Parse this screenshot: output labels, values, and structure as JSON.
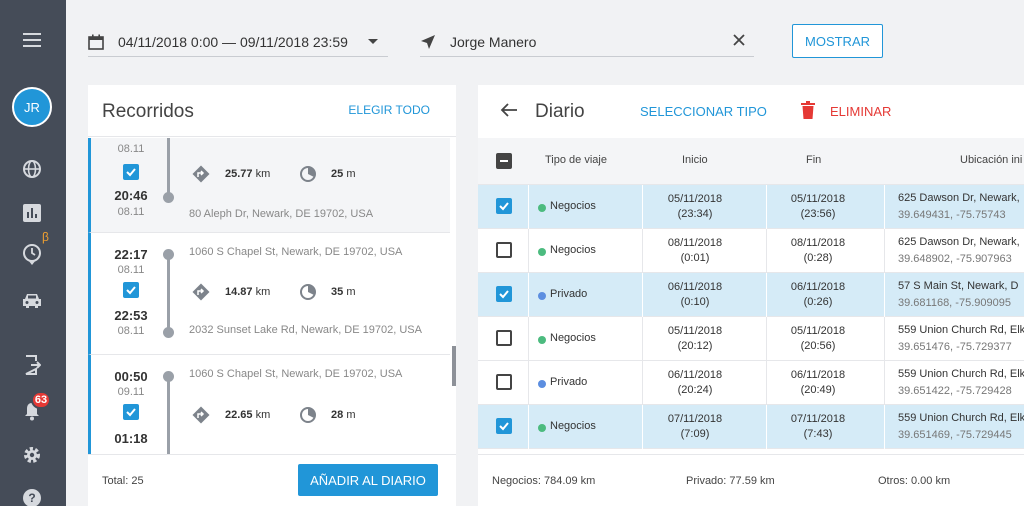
{
  "sidebar": {
    "avatar_initials": "JR",
    "beta_mark": "β",
    "notification_count": "63",
    "icons": [
      "menu-icon",
      "globe-icon",
      "bar-chart-icon",
      "clock-pin-icon",
      "car-icon",
      "logout-icon",
      "bell-icon",
      "gear-icon",
      "help-icon"
    ]
  },
  "filters": {
    "date_range": "04/11/2018 0:00 — 09/11/2018 23:59",
    "driver": "Jorge Manero",
    "show_button": "MOSTRAR"
  },
  "trips_panel": {
    "title": "Recorridos",
    "select_all": "ELEGIR TODO",
    "trips": [
      {
        "start_date": "08.11",
        "end_time": "20:46",
        "end_date": "08.11",
        "distance": "25.77",
        "distance_unit": "km",
        "duration": "25",
        "duration_unit": "m",
        "end_address": "80 Aleph Dr, Newark, DE 19702, USA"
      },
      {
        "start_time": "22:17",
        "start_date": "08.11",
        "end_time": "22:53",
        "end_date": "08.11",
        "distance": "14.87",
        "distance_unit": "km",
        "duration": "35",
        "duration_unit": "m",
        "start_address": "1060 S Chapel St, Newark, DE 19702, USA",
        "end_address": "2032 Sunset Lake Rd, Newark, DE 19702, USA"
      },
      {
        "start_time": "00:50",
        "start_date": "09.11",
        "end_time": "01:18",
        "distance": "22.65",
        "distance_unit": "km",
        "duration": "28",
        "duration_unit": "m",
        "start_address": "1060 S Chapel St, Newark, DE 19702, USA"
      }
    ],
    "total": "Total: 25",
    "add_button": "AÑADIR AL DIARIO"
  },
  "diary_panel": {
    "title": "Diario",
    "select_type": "SELECCIONAR TIPO",
    "delete": "ELIMINAR",
    "columns": [
      "Tipo de viaje",
      "Inicio",
      "Fin",
      "Ubicación ini"
    ],
    "rows": [
      {
        "checked": true,
        "type": "Negocios",
        "type_color": "#4cbb7f",
        "start_date": "05/11/2018",
        "start_time": "(23:34)",
        "end_date": "05/11/2018",
        "end_time": "(23:56)",
        "location": "625 Dawson Dr, Newark,",
        "coords": "39.649431, -75.75743"
      },
      {
        "checked": false,
        "type": "Negocios",
        "type_color": "#4cbb7f",
        "start_date": "08/11/2018",
        "start_time": "(0:01)",
        "end_date": "08/11/2018",
        "end_time": "(0:28)",
        "location": "625 Dawson Dr, Newark,",
        "coords": "39.648902, -75.907963"
      },
      {
        "checked": true,
        "type": "Privado",
        "type_color": "#5c8ee0",
        "start_date": "06/11/2018",
        "start_time": "(0:10)",
        "end_date": "06/11/2018",
        "end_time": "(0:26)",
        "location": "57 S Main St, Newark, D",
        "coords": "39.681168, -75.909095"
      },
      {
        "checked": false,
        "type": "Negocios",
        "type_color": "#4cbb7f",
        "start_date": "05/11/2018",
        "start_time": "(20:12)",
        "end_date": "05/11/2018",
        "end_time": "(20:56)",
        "location": "559 Union Church Rd, Elk",
        "coords": "39.651476, -75.729377"
      },
      {
        "checked": false,
        "type": "Privado",
        "type_color": "#5c8ee0",
        "start_date": "06/11/2018",
        "start_time": "(20:24)",
        "end_date": "06/11/2018",
        "end_time": "(20:49)",
        "location": "559 Union Church Rd, Elk",
        "coords": "39.651422, -75.729428"
      },
      {
        "checked": true,
        "type": "Negocios",
        "type_color": "#4cbb7f",
        "start_date": "07/11/2018",
        "start_time": "(7:09)",
        "end_date": "07/11/2018",
        "end_time": "(7:43)",
        "location": "559 Union Church Rd, Elk",
        "coords": "39.651469, -75.729445"
      }
    ],
    "footer": {
      "business": "Negocios: 784.09 km",
      "private": "Privado: 77.59 km",
      "other": "Otros: 0.00 km"
    }
  },
  "colors": {
    "accent": "#2196d8",
    "sidebar": "#454c58",
    "danger": "#e53935",
    "selected_row": "#d5ebf7"
  }
}
